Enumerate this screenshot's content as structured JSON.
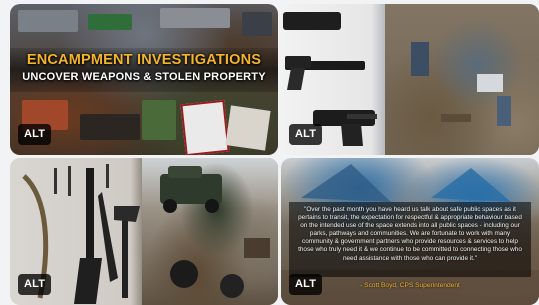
{
  "gallery": {
    "tiles": [
      {
        "headline": "ENCAMPMENT INVESTIGATIONS",
        "subline": "UNCOVER WEAPONS & STOLEN PROPERTY",
        "alt_label": "ALT"
      },
      {
        "alt_label": "ALT"
      },
      {
        "alt_label": "ALT"
      },
      {
        "quote": "\"Over the past month you have heard us talk about safe public spaces as it pertains to transit, the expectation for respectful & appropriate behaviour based on the intended use of the space extends into all public spaces - including our parks, pathways and communities. We are fortunate to work with many community & government partners who provide resources & services to help those who truly need it & we continue to be committed to connecting those who need assistance with those who can provide it.\"",
        "attribution": "- Scott Boyd, CPS Superintendent",
        "alt_label": "ALT"
      }
    ]
  },
  "colors": {
    "headline": "#f5b52a",
    "attribution": "#f0b02c",
    "tarp_blue": "#2e6fa8"
  }
}
